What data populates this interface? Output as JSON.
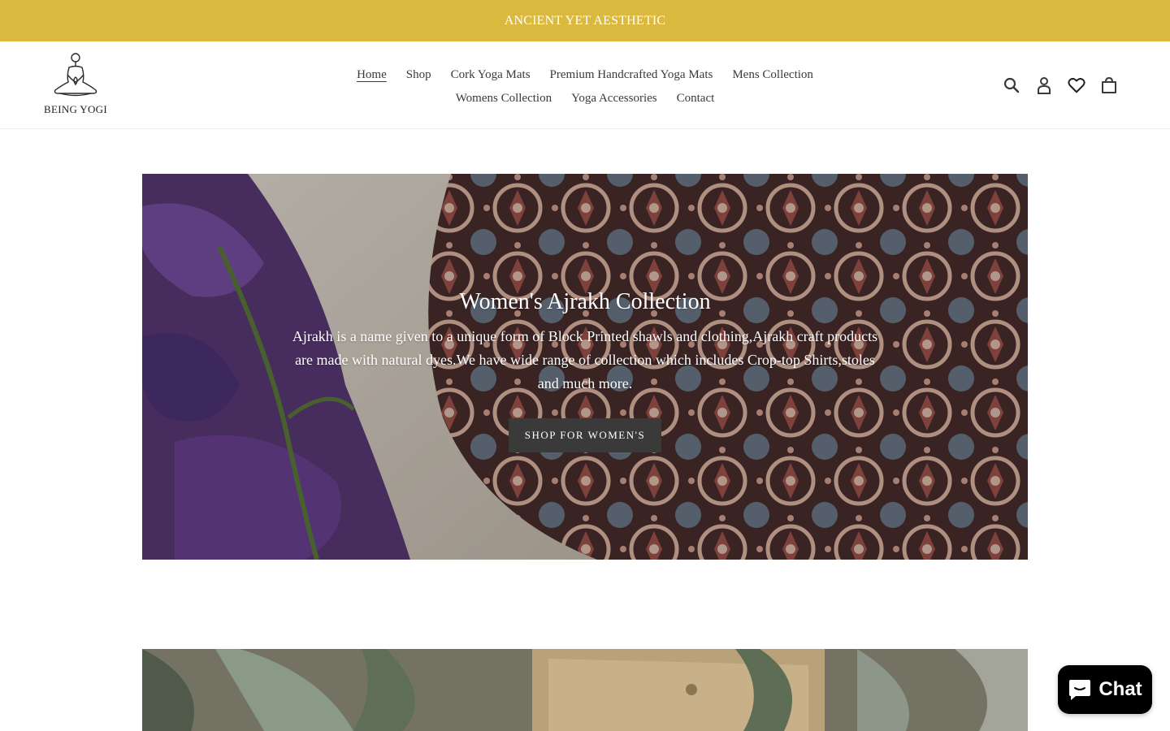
{
  "announcement": {
    "text": "ANCIENT YET AESTHETIC",
    "bg_color": "#dbb93f"
  },
  "logo": {
    "text": "BEING YOGI",
    "icon": "meditating-yogi-icon"
  },
  "nav": {
    "row1": [
      {
        "label": "Home",
        "active": true
      },
      {
        "label": "Shop"
      },
      {
        "label": "Cork Yoga Mats"
      },
      {
        "label": "Premium Handcrafted Yoga Mats"
      },
      {
        "label": "Mens Collection"
      }
    ],
    "row2": [
      {
        "label": "Womens Collection"
      },
      {
        "label": "Yoga Accessories"
      },
      {
        "label": "Contact"
      }
    ]
  },
  "header_icons": [
    "search-icon",
    "account-icon",
    "wishlist-heart-icon",
    "cart-icon"
  ],
  "hero": {
    "title": "Women's Ajrakh Collection",
    "text": "Ajrakh is a name given to a unique form of Block Printed shawls and clothing,Ajrakh craft products are made with natural dyes.We have wide range of collection which includes Crop-top Shirts,stoles and much more.",
    "button": "SHOP FOR WOMEN'S",
    "button_color": "#3a3a3a"
  },
  "chat": {
    "label": "Chat",
    "icon": "chat-bubble-icon"
  }
}
